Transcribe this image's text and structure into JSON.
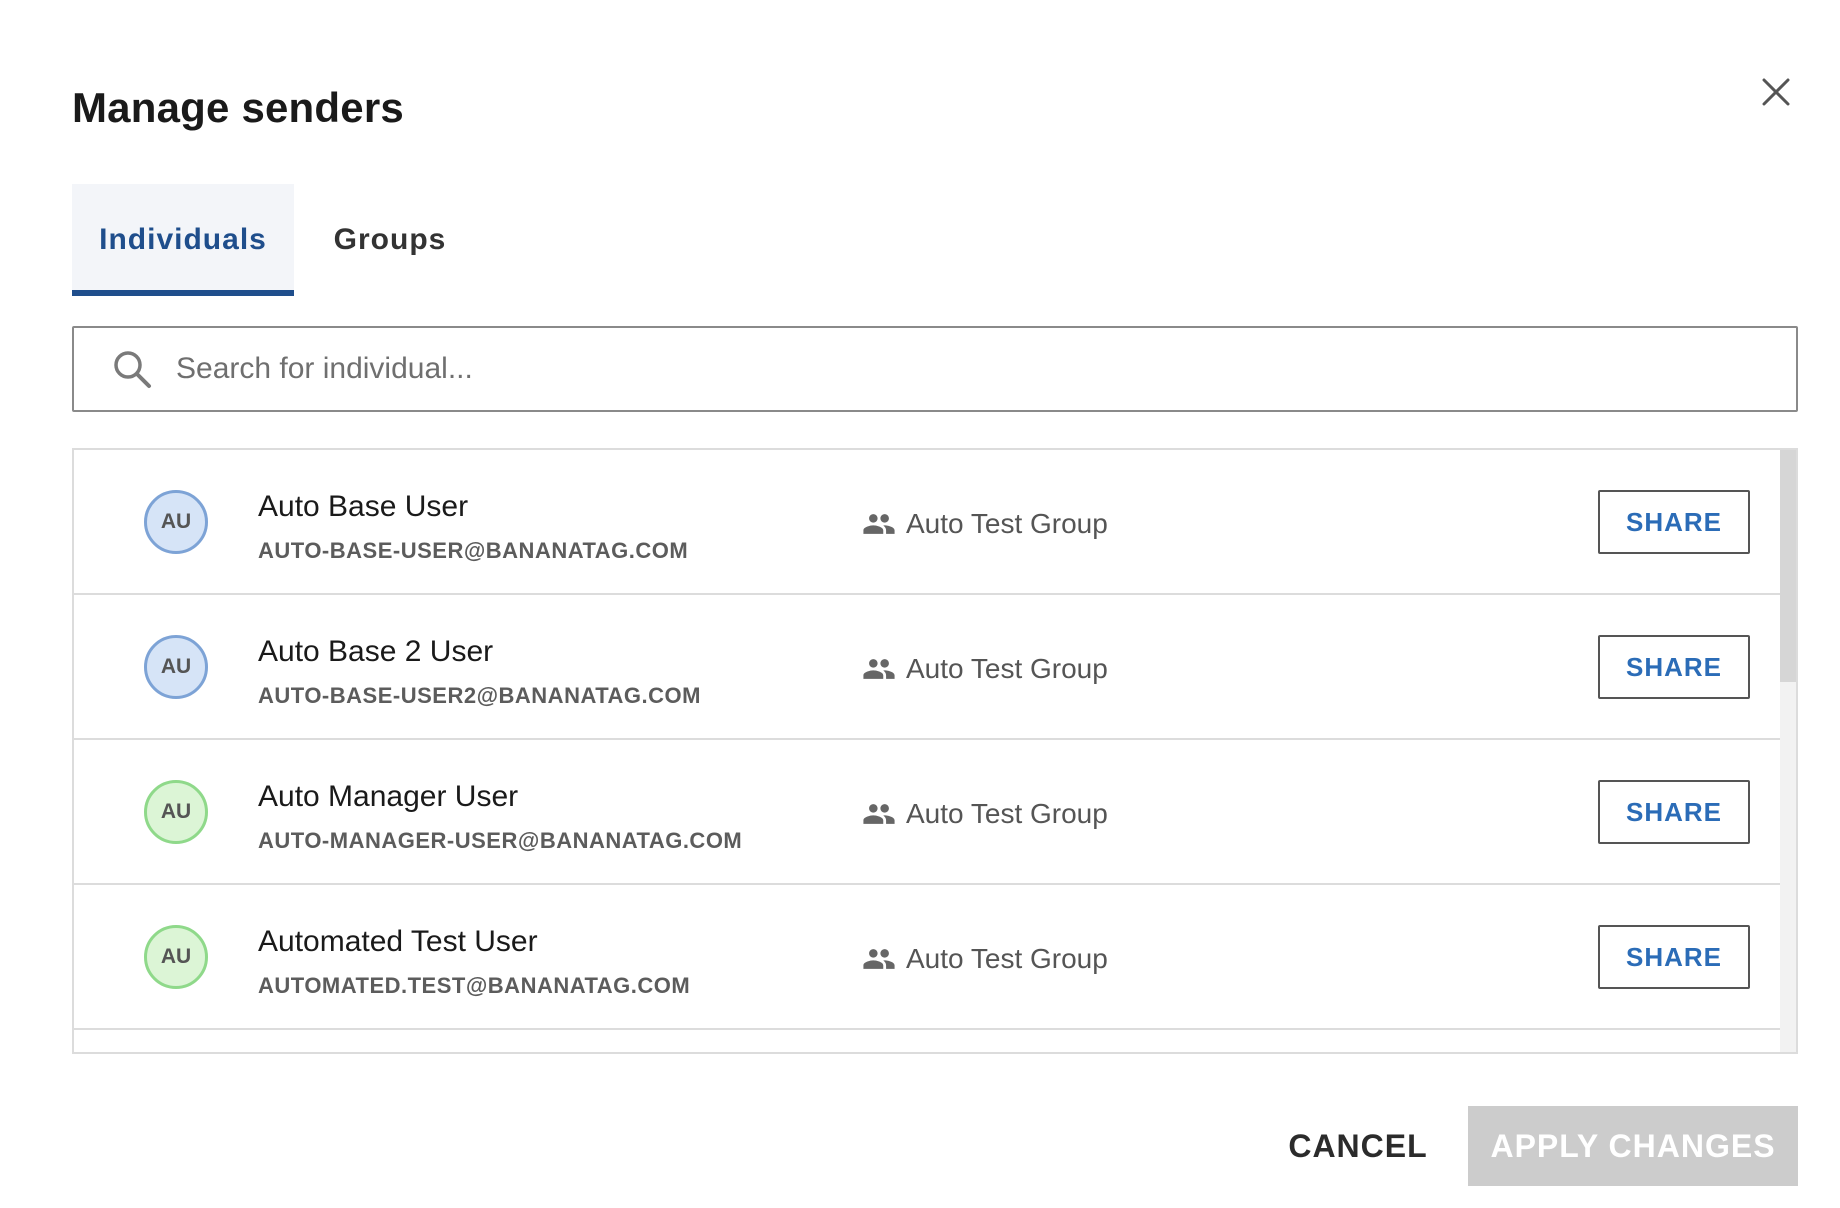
{
  "dialog": {
    "title": "Manage senders",
    "close_icon": "close-icon"
  },
  "tabs": [
    {
      "label": "Individuals",
      "active": true
    },
    {
      "label": "Groups",
      "active": false
    }
  ],
  "search": {
    "placeholder": "Search for individual...",
    "value": "",
    "icon": "search-icon"
  },
  "senders": [
    {
      "initials": "AU",
      "avatar_color": "blue",
      "name": "Auto Base User",
      "email": "AUTO-BASE-USER@BANANATAG.COM",
      "group": "Auto Test Group",
      "share_label": "SHARE"
    },
    {
      "initials": "AU",
      "avatar_color": "blue",
      "name": "Auto Base 2 User",
      "email": "AUTO-BASE-USER2@BANANATAG.COM",
      "group": "Auto Test Group",
      "share_label": "SHARE"
    },
    {
      "initials": "AU",
      "avatar_color": "green",
      "name": "Auto Manager User",
      "email": "AUTO-MANAGER-USER@BANANATAG.COM",
      "group": "Auto Test Group",
      "share_label": "SHARE"
    },
    {
      "initials": "AU",
      "avatar_color": "green",
      "name": "Automated Test User",
      "email": "AUTOMATED.TEST@BANANATAG.COM",
      "group": "Auto Test Group",
      "share_label": "SHARE"
    }
  ],
  "footer": {
    "cancel_label": "CANCEL",
    "apply_label": "APPLY CHANGES"
  },
  "colors": {
    "accent": "#1f4e8c",
    "share_text": "#2b6cb7",
    "apply_disabled": "#cccccc",
    "avatar_blue_bg": "#d6e4f7",
    "avatar_green_bg": "#dcf5d6"
  }
}
